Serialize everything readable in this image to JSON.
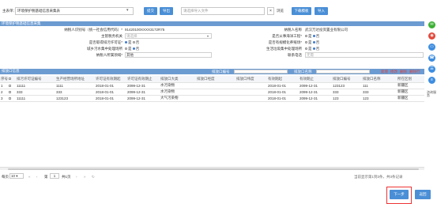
{
  "toolbar": {
    "select_prefix": "主表单：",
    "select_value": "环境保护税基础信息采集表",
    "confirm_label": "提交",
    "export_label": "导出",
    "file_placeholder": "请选择导入文件",
    "browse_label": "浏览",
    "download_template_label": "下载模板",
    "import_label": "导入"
  },
  "section1": {
    "title": "环境保护税基础信息采集",
    "taxpayer_id_label": "纳税人识别号（统一社会信用代码）*",
    "taxpayer_id_value": "91420100XXXX3172R75",
    "taxpayer_name_label": "纳税人名称",
    "taxpayer_name_value": "武汉万达投资置业有限公司",
    "main_org_label": "主管税务机关",
    "main_org_value": "请选择",
    "construction_label": "是否从事海洋工程*",
    "yes_label": "是",
    "no_label": "否",
    "permit_label": "是否取得排污许可证*",
    "urban_label": "是否有规模化养殖场*",
    "urban_sewage_label": "城乡污水集中处理场所",
    "waste_label": "生活垃圾集中处理场所",
    "taxpayer_type_label": "纳税人所属领域*",
    "taxpayer_type_value": "其他",
    "contact_label": "联系电话",
    "contact_value": "无需"
  },
  "section2": {
    "title": "排放口信息",
    "filter1_label": "排放口编号",
    "filter2_label": "排放口名称",
    "action_add": "新增",
    "action_edit": "修改",
    "action_delete": "删除",
    "action_delete_row": "删除行"
  },
  "table": {
    "headers": [
      "序号",
      "",
      "排污许可证编号",
      "生产经营场所地址",
      "许可证有效期起",
      "许可证有效期止",
      "排放口大类",
      "排放口经度",
      "排放口纬度",
      "有效期起",
      "有效期止",
      "排放口编号",
      "排放口名称",
      "所在区划"
    ],
    "rows": [
      [
        "1",
        "",
        "11111",
        "1111",
        "2018-01-01",
        "2099-12-31",
        "水污染物",
        "",
        "",
        "2018-01-01",
        "2099-12-31",
        "123123",
        "111",
        "新疆区"
      ],
      [
        "2",
        "",
        "333",
        "333",
        "2018-01-01",
        "2099-12-31",
        "水污染物",
        "",
        "",
        "2018-01-01",
        "2099-12-31",
        "333",
        "333",
        "新疆区"
      ],
      [
        "3",
        "",
        "11111",
        "123123",
        "2018-01-01",
        "2099-12-31",
        "大气污染物",
        "",
        "",
        "2018-01-01",
        "2099-12-31",
        "123",
        "123",
        "新疆区"
      ]
    ]
  },
  "pager": {
    "per_page_label": "每页",
    "per_page_value": "10",
    "page_label": "第",
    "page_value": "1",
    "page_total": "共1页",
    "summary": "当前显示第1到3条，共3条记录"
  },
  "footer": {
    "next_label": "下一步",
    "back_label": "返回"
  },
  "side_icons": [
    "wechat-icon",
    "weibo-icon",
    "pc-icon",
    "phone-icon",
    "chat-icon",
    "list-icon"
  ],
  "side_texts": {
    "consult": "咨询服务",
    "zone": "区划"
  }
}
